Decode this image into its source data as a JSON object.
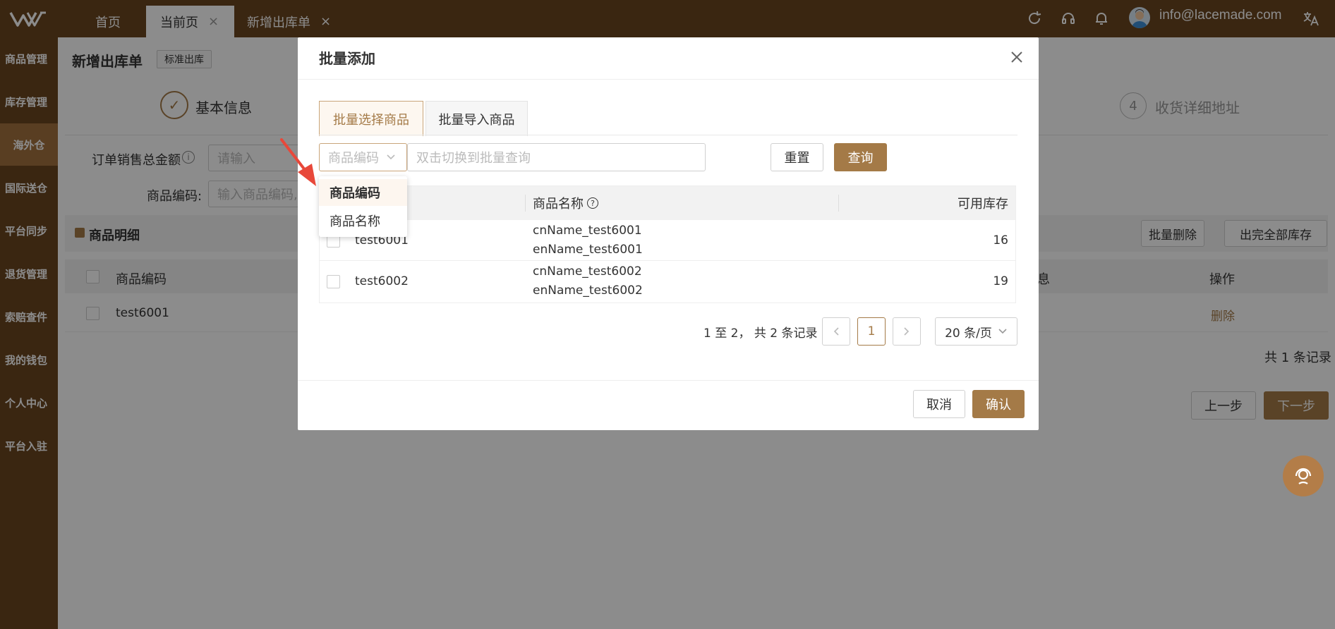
{
  "topbar": {
    "tabs": [
      {
        "label": "首页"
      },
      {
        "label": "当前页",
        "close": "×"
      },
      {
        "label": "新增出库单",
        "close": "×"
      }
    ],
    "user_email": "info@lacemade.com"
  },
  "sidebar": {
    "items": [
      {
        "label": "商品管理"
      },
      {
        "label": "库存管理"
      },
      {
        "label": "海外仓"
      },
      {
        "label": "国际送仓"
      },
      {
        "label": "平台同步"
      },
      {
        "label": "退货管理"
      },
      {
        "label": "索赔查件"
      },
      {
        "label": "我的钱包"
      },
      {
        "label": "个人中心"
      },
      {
        "label": "平台入驻"
      }
    ]
  },
  "page": {
    "title": "新增出库单",
    "tag": "标准出库",
    "steps": [
      {
        "number": "✓",
        "label": "基本信息"
      },
      {
        "number": "4",
        "label": "收货详细地址"
      }
    ],
    "form": {
      "order_total_label": "订单销售总金额",
      "order_total_placeholder": "请输入",
      "sku_label": "商品编码:",
      "sku_placeholder": "输入商品编码,"
    },
    "details": {
      "title": "商品明细",
      "batch_delete": "批量删除",
      "ship_all": "出完全部库存",
      "columns": {
        "sku": "商品编码",
        "info_fragment": "息",
        "action": "操作"
      },
      "rows": [
        {
          "sku": "test6001",
          "action": "删除"
        }
      ],
      "total": "共 1 条记录"
    },
    "prev_step": "上一步",
    "next_step": "下一步"
  },
  "modal": {
    "title": "批量添加",
    "tabs": [
      {
        "label": "批量选择商品"
      },
      {
        "label": "批量导入商品"
      }
    ],
    "filter": {
      "select_value": "商品编码",
      "search_placeholder": "双击切换到批量查询",
      "reset": "重置",
      "query": "查询"
    },
    "dropdown": {
      "options": [
        {
          "label": "商品编码"
        },
        {
          "label": "商品名称"
        }
      ]
    },
    "table": {
      "columns": {
        "name": "商品名称",
        "stock": "可用库存"
      },
      "rows": [
        {
          "sku": "test6001",
          "cn": "cnName_test6001",
          "en": "enName_test6001",
          "stock": "16"
        },
        {
          "sku": "test6002",
          "cn": "cnName_test6002",
          "en": "enName_test6002",
          "stock": "19"
        }
      ]
    },
    "pagination": {
      "summary": "1 至 2， 共 2 条记录",
      "current": "1",
      "page_size": "20 条/页"
    },
    "cancel": "取消",
    "confirm": "确认"
  },
  "colors": {
    "brand": "#6b4520",
    "accent": "#a47a47",
    "sidebar_active": "#a3713f",
    "arrow": "#e8483a"
  }
}
